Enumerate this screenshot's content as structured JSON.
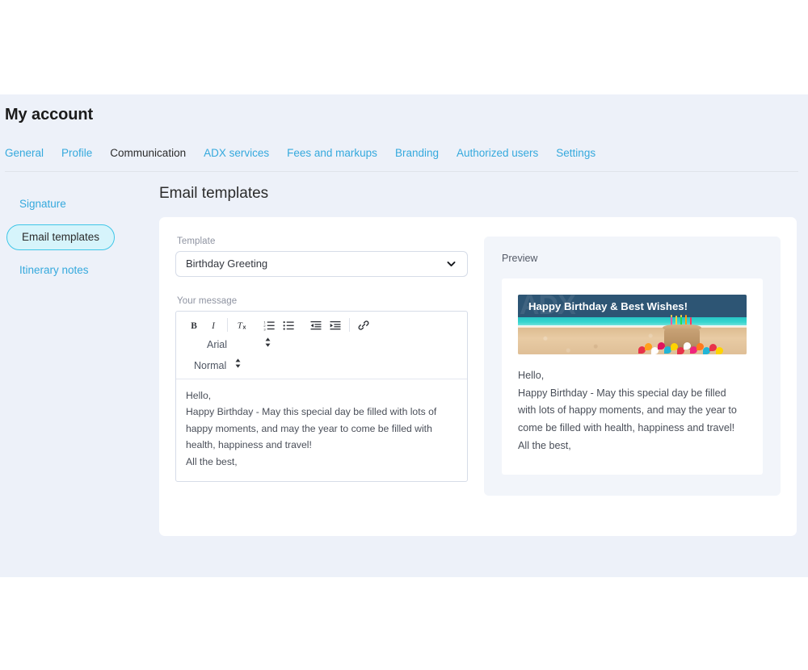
{
  "header": {
    "title": "My account",
    "tabs": [
      {
        "label": "General",
        "active": false
      },
      {
        "label": "Profile",
        "active": false
      },
      {
        "label": "Communication",
        "active": true
      },
      {
        "label": "ADX services",
        "active": false
      },
      {
        "label": "Fees and markups",
        "active": false
      },
      {
        "label": "Branding",
        "active": false
      },
      {
        "label": "Authorized users",
        "active": false
      },
      {
        "label": "Settings",
        "active": false
      }
    ]
  },
  "sidebar": {
    "items": [
      {
        "label": "Signature",
        "active": false
      },
      {
        "label": "Email templates",
        "active": true
      },
      {
        "label": "Itinerary notes",
        "active": false
      }
    ]
  },
  "main": {
    "section_title": "Email templates",
    "template_field": {
      "label": "Template",
      "selected": "Birthday Greeting",
      "options": [
        "Birthday Greeting"
      ]
    },
    "message_field": {
      "label": "Your message",
      "lines": [
        "Hello,",
        "Happy Birthday - May this special day be filled with lots of happy moments, and may the year to come be filled with health, happiness and travel!",
        "All the best,"
      ]
    },
    "toolbar": {
      "bold": "B",
      "italic": "I",
      "clear_format": "Tx",
      "ordered_list": "ordered-list",
      "bullet_list": "bullet-list",
      "outdent": "outdent",
      "indent": "indent",
      "link": "link",
      "font_value": "Arial",
      "size_value": "Normal"
    }
  },
  "preview": {
    "label": "Preview",
    "banner_title": "Happy Birthday & Best Wishes!",
    "banner_watermark": "ADX",
    "lines": [
      "Hello,",
      "Happy Birthday - May this special day be filled with lots of happy moments, and may the year to come be filled with health, happiness and travel!",
      "All the best,"
    ]
  },
  "colors": {
    "app_background": "#edf1f9",
    "link": "#35a9dd",
    "active_pill_bg": "#d6f4fb",
    "active_pill_border": "#3fc6e8",
    "card": "#ffffff",
    "preview_panel": "#f2f5fa",
    "banner_sky": "#2d5574",
    "banner_sea": "#28c6c6",
    "banner_sand": "#e0c094",
    "text": "#4a4f59"
  }
}
